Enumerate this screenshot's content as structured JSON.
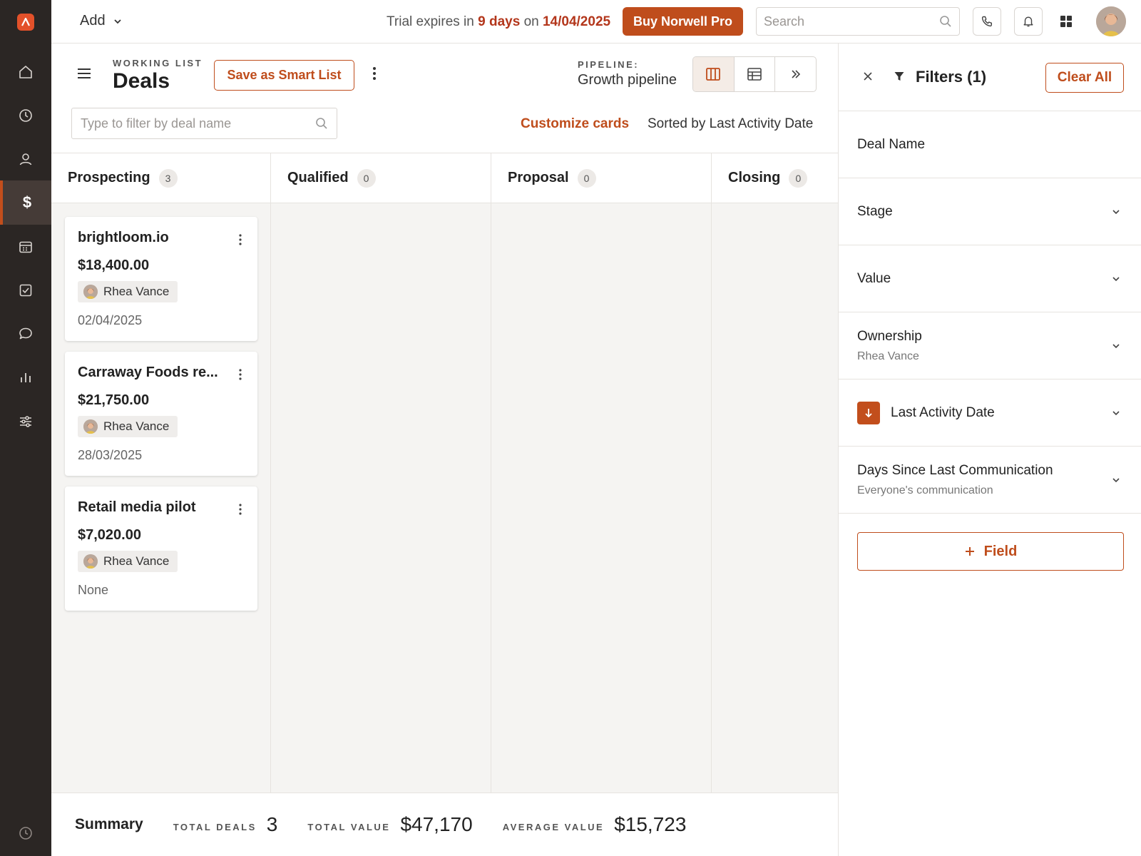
{
  "topbar": {
    "add_label": "Add",
    "trial": {
      "prefix": "Trial expires in",
      "days": "9 days",
      "mid": "on",
      "date": "14/04/2025"
    },
    "buy_label": "Buy Norwell Pro",
    "search_placeholder": "Search"
  },
  "header": {
    "working_list_label": "WORKING LIST",
    "title": "Deals",
    "save_smart_list": "Save as Smart List",
    "pipeline_label": "PIPELINE:",
    "pipeline_name": "Growth pipeline",
    "filter_placeholder": "Type to filter by deal name",
    "customize_cards": "Customize cards",
    "sorted_by": "Sorted by Last Activity Date"
  },
  "columns": [
    {
      "title": "Prospecting",
      "count": "3"
    },
    {
      "title": "Qualified",
      "count": "0"
    },
    {
      "title": "Proposal",
      "count": "0"
    },
    {
      "title": "Closing",
      "count": "0"
    }
  ],
  "cards": [
    {
      "title": "brightloom.io",
      "value": "$18,400.00",
      "owner": "Rhea Vance",
      "date": "02/04/2025"
    },
    {
      "title": "Carraway Foods re...",
      "value": "$21,750.00",
      "owner": "Rhea Vance",
      "date": "28/03/2025"
    },
    {
      "title": "Retail media pilot",
      "value": "$7,020.00",
      "owner": "Rhea Vance",
      "date": "None"
    }
  ],
  "summary": {
    "title": "Summary",
    "total_deals_label": "TOTAL DEALS",
    "total_deals": "3",
    "total_value_label": "TOTAL VALUE",
    "total_value": "$47,170",
    "average_value_label": "AVERAGE VALUE",
    "average_value": "$15,723"
  },
  "filters": {
    "title": "Filters (1)",
    "clear_all": "Clear All",
    "rows": [
      {
        "label": "Deal Name"
      },
      {
        "label": "Stage"
      },
      {
        "label": "Value"
      },
      {
        "label": "Ownership",
        "sub": "Rhea Vance"
      },
      {
        "label": "Last Activity Date"
      },
      {
        "label": "Days Since Last Communication",
        "sub": "Everyone's communication"
      }
    ],
    "add_field": "Field"
  },
  "icons": {
    "rail": [
      "home-icon",
      "clock-icon",
      "person-icon",
      "dollar-icon",
      "calendar-icon",
      "checkbox-icon",
      "chat-icon",
      "bar-chart-icon",
      "sliders-icon",
      "history-icon"
    ],
    "accent": "#bf4d1c",
    "trial_highlight": "#b3361b",
    "rail_bg": "#2b2624"
  }
}
